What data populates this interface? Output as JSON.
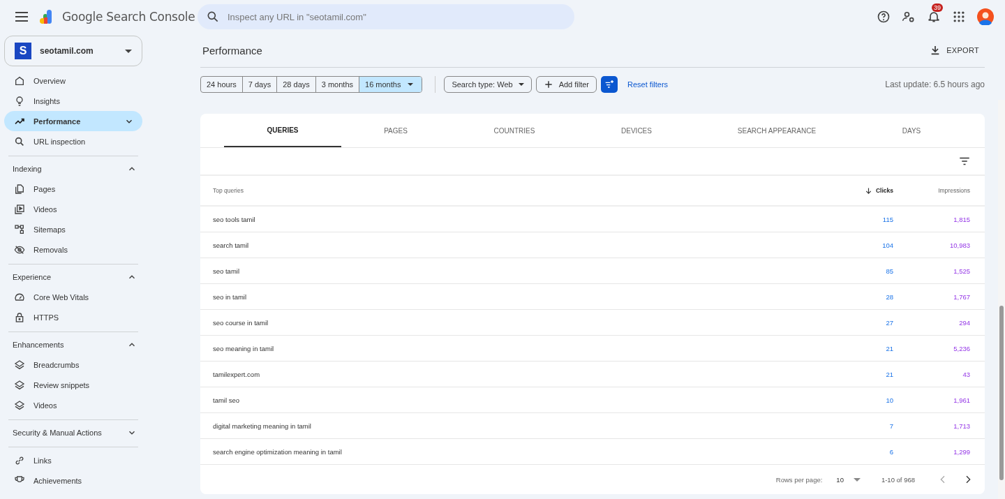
{
  "app": {
    "title": "Google Search Console"
  },
  "search": {
    "placeholder": "Inspect any URL in \"seotamil.com\""
  },
  "header": {
    "notifications": "39"
  },
  "property": {
    "initial": "S",
    "name": "seotamil.com"
  },
  "sidebar": {
    "top_items": [
      {
        "label": "Overview",
        "selected": false
      },
      {
        "label": "Insights",
        "selected": false
      },
      {
        "label": "Performance",
        "selected": true
      },
      {
        "label": "URL inspection",
        "selected": false
      }
    ],
    "sections": [
      {
        "title": "Indexing",
        "expanded": true,
        "items": [
          {
            "label": "Pages",
            "selected": false
          },
          {
            "label": "Videos",
            "selected": false
          },
          {
            "label": "Sitemaps",
            "selected": false
          },
          {
            "label": "Removals",
            "selected": false
          }
        ]
      },
      {
        "title": "Experience",
        "expanded": true,
        "items": [
          {
            "label": "Core Web Vitals",
            "selected": false
          },
          {
            "label": "HTTPS",
            "selected": false
          }
        ]
      },
      {
        "title": "Enhancements",
        "expanded": true,
        "items": [
          {
            "label": "Breadcrumbs",
            "selected": false
          },
          {
            "label": "Review snippets",
            "selected": false
          },
          {
            "label": "Videos",
            "selected": false
          }
        ]
      },
      {
        "title": "Security & Manual Actions",
        "expanded": false
      }
    ],
    "bottom_items": [
      {
        "label": "Links",
        "selected": false
      },
      {
        "label": "Achievements",
        "selected": false
      }
    ]
  },
  "page": {
    "title": "Performance",
    "export": "EXPORT",
    "last_update": "Last update: 6.5 hours ago"
  },
  "date_ranges": [
    {
      "label": "24 hours",
      "selected": false
    },
    {
      "label": "7 days",
      "selected": false
    },
    {
      "label": "28 days",
      "selected": false
    },
    {
      "label": "3 months",
      "selected": false
    },
    {
      "label": "16 months",
      "selected": true
    }
  ],
  "filters": {
    "search_type": "Search type: Web",
    "add_filter": "Add filter",
    "reset": "Reset filters"
  },
  "tabs": [
    {
      "label": "QUERIES",
      "selected": true
    },
    {
      "label": "PAGES",
      "selected": false
    },
    {
      "label": "COUNTRIES",
      "selected": false
    },
    {
      "label": "DEVICES",
      "selected": false
    },
    {
      "label": "SEARCH APPEARANCE",
      "selected": false
    },
    {
      "label": "DAYS",
      "selected": false
    }
  ],
  "table": {
    "columns": [
      {
        "label": "Top queries",
        "sorted": false
      },
      {
        "label": "Clicks",
        "sorted": true
      },
      {
        "label": "Impressions",
        "sorted": false
      }
    ],
    "rows": [
      [
        "seo tools tamil",
        "115",
        "1,815"
      ],
      [
        "search tamil",
        "104",
        "10,983"
      ],
      [
        "seo tamil",
        "85",
        "1,525"
      ],
      [
        "seo in tamil",
        "28",
        "1,767"
      ],
      [
        "seo course in tamil",
        "27",
        "294"
      ],
      [
        "seo meaning in tamil",
        "21",
        "5,236"
      ],
      [
        "tamilexpert.com",
        "21",
        "43"
      ],
      [
        "tamil seo",
        "10",
        "1,961"
      ],
      [
        "digital marketing meaning in tamil",
        "7",
        "1,713"
      ],
      [
        "search engine optimization meaning in tamil",
        "6",
        "1,299"
      ]
    ]
  },
  "pagination": {
    "rows_per_page_label": "Rows per page:",
    "rows_per_page": "10",
    "range": "1-10 of 968"
  }
}
